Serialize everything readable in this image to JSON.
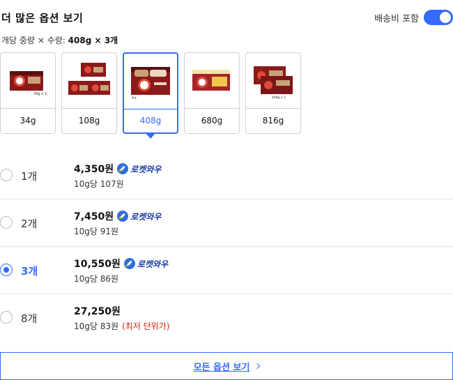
{
  "header": {
    "title": "더 많은 옵션 보기",
    "shipping_label": "배송비 포함",
    "shipping_toggle_on": true
  },
  "subtitle": {
    "key1": "개당 중량",
    "sep": "×",
    "key2": "수량:",
    "value": "408g × 3개"
  },
  "thumbnails": [
    {
      "label": "34g",
      "selected": false,
      "icon": "product-single-box"
    },
    {
      "label": "108g",
      "selected": false,
      "icon": "product-three-boxes"
    },
    {
      "label": "408g",
      "selected": true,
      "icon": "product-large-box"
    },
    {
      "label": "680g",
      "selected": false,
      "icon": "product-wide-box"
    },
    {
      "label": "816g",
      "selected": false,
      "icon": "product-two-boxes"
    }
  ],
  "options": [
    {
      "qty": "1개",
      "price": "4,350원",
      "badge": "로켓와우",
      "unit": "10g당 107원",
      "note": "",
      "selected": false
    },
    {
      "qty": "2개",
      "price": "7,450원",
      "badge": "로켓와우",
      "unit": "10g당 91원",
      "note": "",
      "selected": false
    },
    {
      "qty": "3개",
      "price": "10,550원",
      "badge": "로켓와우",
      "unit": "10g당 86원",
      "note": "",
      "selected": true
    },
    {
      "qty": "8개",
      "price": "27,250원",
      "badge": "",
      "unit": "10g당 83원",
      "note": "(최저 단위가)",
      "selected": false
    }
  ],
  "all_options_label": "모든 옵션 보기",
  "colors": {
    "accent": "#346aff",
    "rocket": "#1a3aa8",
    "lowest": "#c9250e"
  }
}
